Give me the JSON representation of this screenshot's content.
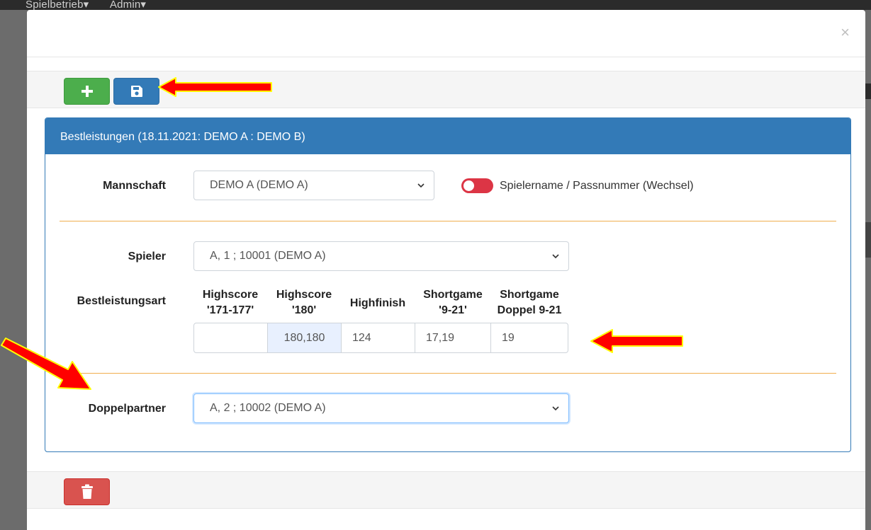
{
  "backdrop": {
    "nav_items": [
      "Spielbetrieb▾",
      "Admin▾"
    ]
  },
  "modal": {
    "close_label": "×"
  },
  "panel": {
    "title": "Bestleistungen (18.11.2021: DEMO A : DEMO B)"
  },
  "form": {
    "mannschaft_label": "Mannschaft",
    "mannschaft_value": "DEMO A (DEMO A)",
    "toggle_label": "Spielername / Passnummer (Wechsel)",
    "spieler_label": "Spieler",
    "spieler_value": "A, 1 ; 10001 (DEMO A)",
    "bestleistungsart_label": "Bestleistungsart",
    "columns": [
      {
        "header_line1": "Highscore",
        "header_line2": "'171-177'",
        "value": ""
      },
      {
        "header_line1": "Highscore",
        "header_line2": "'180'",
        "value": "180,180"
      },
      {
        "header_line1": "Highfinish",
        "header_line2": "",
        "value": "124"
      },
      {
        "header_line1": "Shortgame",
        "header_line2": "'9-21'",
        "value": "17,19"
      },
      {
        "header_line1": "Shortgame",
        "header_line2": "Doppel 9-21",
        "value": "19"
      }
    ],
    "doppelpartner_label": "Doppelpartner",
    "doppelpartner_value": "A, 2 ; 10002 (DEMO A)"
  },
  "colors": {
    "primary": "#337ab7",
    "success": "#4cae4c",
    "danger": "#d9534f",
    "divider": "#f0ad4e",
    "toggle_off": "#dc3545",
    "annotation_arrow": "#ff0000",
    "annotation_outline": "#ffff00"
  }
}
